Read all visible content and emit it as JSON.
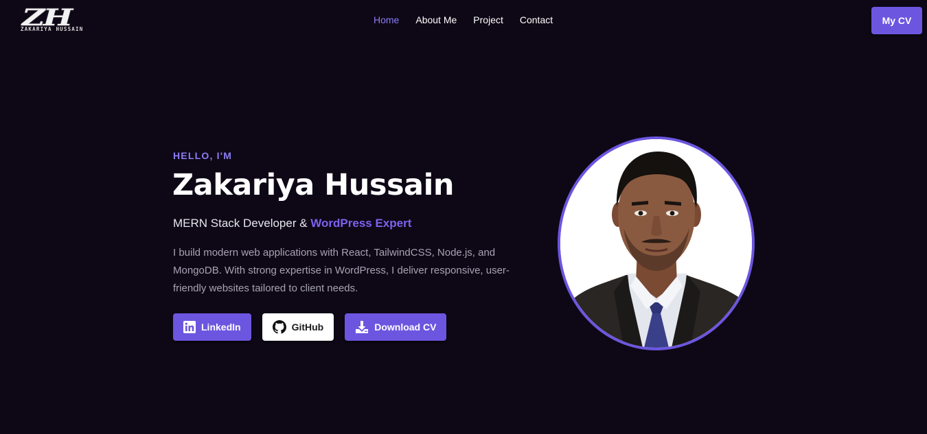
{
  "logo": {
    "mark": "ZH",
    "subtitle": "ZAKARIYA HUSSAIN"
  },
  "nav": {
    "items": [
      {
        "label": "Home",
        "active": true
      },
      {
        "label": "About Me",
        "active": false
      },
      {
        "label": "Project",
        "active": false
      },
      {
        "label": "Contact",
        "active": false
      }
    ]
  },
  "header": {
    "cv_button": "My CV"
  },
  "hero": {
    "greeting": "HELLO, I'M",
    "name": "Zakariya Hussain",
    "role_prefix": "MERN Stack Developer & ",
    "role_highlight": "WordPress Expert",
    "description": "I build modern web applications with React, TailwindCSS, Node.js, and MongoDB. With strong expertise in WordPress, I deliver responsive, user-friendly websites tailored to client needs.",
    "buttons": {
      "linkedin": "LinkedIn",
      "github": "GitHub",
      "download": "Download CV"
    }
  },
  "colors": {
    "background": "#0e0816",
    "accent": "#6c56e0",
    "accent_text": "#8b7cf6"
  },
  "icons": [
    "linkedin-icon",
    "github-icon",
    "download-icon"
  ]
}
